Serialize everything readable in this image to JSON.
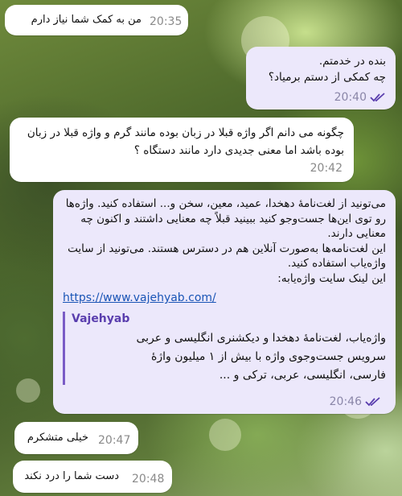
{
  "messages": [
    {
      "text": "من به کمک شما نیاز دارم",
      "time": "20:35"
    },
    {
      "text": "بنده در خدمتم.\nچه کمکی از دستم برمیاد؟",
      "time": "20:40",
      "status": "read-double-check-icon"
    },
    {
      "text": "چگونه می دانم اگر واژه قبلا در زبان بوده مانند گرم و واژه قبلا در زبان بوده باشد اما معنی جدیدی دارد مانند دستگاه ؟",
      "time": "20:42"
    },
    {
      "text": "می‌تونید از لغت‌نامۀ دهخدا، عمید، معین، سخن و... استفاده کنید. واژه‌ها رو توی این‌ها جست‌وجو کنید ببینید قبلاً چه معنایی داشتند و اکنون چه معنایی دارند.\nاین لغت‌نامه‌ها به‌صورت آنلاین هم در دسترس هستند. می‌تونید از سایت واژه‌یاب استفاده کنید.\nاین لینک سایت واژه‌یابه:",
      "link": "https://www.vajehyab.com/",
      "preview_title": "Vajehyab",
      "preview_text": "واژه‌یاب، لغت‌نامۀ دهخدا و دیکشنری انگلیسی و عربی\nسرویس جست‌وجوی واژه با بیش از ۱ میلیون واژۀ\nفارسی، انگلیسی، عربی، ترکی و ...",
      "time": "20:46",
      "status": "read-double-check-icon"
    },
    {
      "text": "خیلی متشکرم",
      "time": "20:47"
    },
    {
      "text": "دست شما را درد نکند",
      "time": "20:48"
    }
  ],
  "colors": {
    "incoming_bubble": "#ffffff",
    "outgoing_bubble": "#ece8fb",
    "link": "#1a55b6",
    "accent": "#5a3eae",
    "check": "#5a3eae"
  }
}
